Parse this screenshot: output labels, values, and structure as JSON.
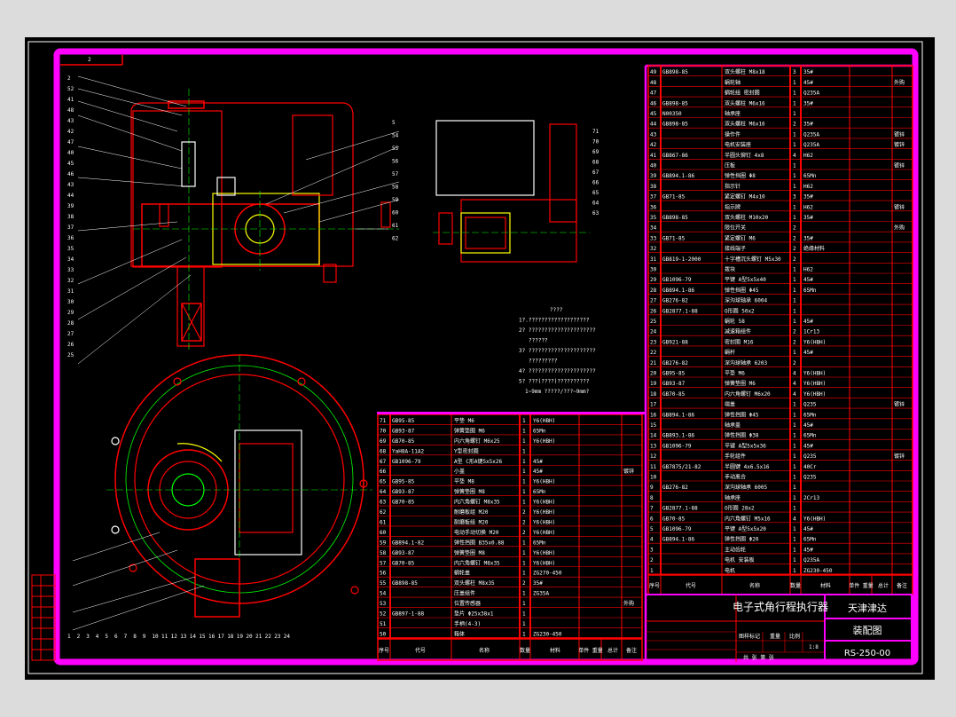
{
  "title_block": {
    "product_name": "电子式角行程执行器",
    "company": "天津津达",
    "drawing_type": "装配图",
    "drawing_number": "RS-250-00",
    "scale": "1:8",
    "headers": [
      "图样标记",
      "重量",
      "比例"
    ],
    "count_label": "共 张 第 张"
  },
  "bom_headers": [
    "序号",
    "代号",
    "名称",
    "数量",
    "材料",
    "单件 重量",
    "总计",
    "备注"
  ],
  "frame_label": "2",
  "notes": [
    "????",
    "1?.???????????????????",
    "2? ?????????????????????",
    "??????",
    "3? ?????????????????????",
    "?????????",
    "4? ?????????????????????",
    "5? ???(????)??????????",
    "1~9mm ?????/???~9mm?"
  ],
  "bom_left": [
    [
      "71",
      "GB95-85",
      "平垫 M6",
      "1",
      "Y6(HBH)",
      ""
    ],
    [
      "70",
      "GB93-87",
      "弹簧垫圈 M6",
      "1",
      "65Mn",
      ""
    ],
    [
      "69",
      "GB70-85",
      "内六角螺钉 M6x25",
      "1",
      "Y6(HBH)",
      ""
    ],
    [
      "68",
      "YaH8A-11A2",
      "Y型密封圈",
      "1",
      "",
      ""
    ],
    [
      "67",
      "GB1096-79",
      "A型 C形A键5x5x26",
      "1",
      "45#",
      ""
    ],
    [
      "66",
      "",
      "小盖",
      "1",
      "45#",
      "镀锌"
    ],
    [
      "65",
      "GB95-85",
      "平垫 M8",
      "1",
      "Y6(HBH)",
      ""
    ],
    [
      "64",
      "GB93-87",
      "弹簧垫圈 M8",
      "1",
      "65Mn",
      ""
    ],
    [
      "63",
      "GB70-85",
      "内六角螺钉 M8x35",
      "1",
      "Y6(HBH)",
      ""
    ],
    [
      "62",
      "",
      "耐磨板组 M20",
      "2",
      "Y6(HBH)",
      ""
    ],
    [
      "61",
      "",
      "耐磨板组 M20",
      "2",
      "Y6(HBH)",
      ""
    ],
    [
      "60",
      "",
      "电动手动切换 M20",
      "2",
      "Y6(HBH)",
      ""
    ],
    [
      "59",
      "GB894.1-82",
      "弹性挡圈 B35x0.88",
      "1",
      "65Mn",
      ""
    ],
    [
      "58",
      "GB93-87",
      "弹簧垫圈 M8",
      "1",
      "Y6(HBH)",
      ""
    ],
    [
      "57",
      "GB70-85",
      "内六角螺钉 M8x35",
      "1",
      "Y6(HBH)",
      ""
    ],
    [
      "56",
      "",
      "蜗轮盖",
      "1",
      "ZG270-450",
      ""
    ],
    [
      "55",
      "GB898-85",
      "双头螺柱 M8x35",
      "2",
      "35#",
      ""
    ],
    [
      "54",
      "",
      "压盖组件",
      "1",
      "ZG35A",
      ""
    ],
    [
      "53",
      "",
      "位置传感器",
      "1",
      "",
      "外购"
    ],
    [
      "52",
      "GB897-1-88",
      "垫片 Φ25x38x1",
      "1",
      "",
      ""
    ],
    [
      "51",
      "",
      "手柄(4-3)",
      "1",
      "",
      ""
    ],
    [
      "50",
      "",
      "箱体",
      "1",
      "ZG230-450",
      ""
    ]
  ],
  "bom_right": [
    [
      "49",
      "GB898-85",
      "双头螺柱 M8x18",
      "3",
      "35#",
      ""
    ],
    [
      "48",
      "",
      "蜗轮轴",
      "1",
      "45#",
      "外购"
    ],
    [
      "47",
      "",
      "蜗轮组 密封圈",
      "1",
      "Q235A",
      ""
    ],
    [
      "46",
      "GB898-85",
      "双头螺柱 M6x16",
      "1",
      "35#",
      ""
    ],
    [
      "45",
      "N00350",
      "轴承座",
      "1",
      "",
      ""
    ],
    [
      "44",
      "GB898-85",
      "双头螺柱 M6x16",
      "2",
      "35#",
      ""
    ],
    [
      "43",
      "",
      "操作件",
      "1",
      "Q235A",
      "镀锌"
    ],
    [
      "42",
      "",
      "电机安装座",
      "1",
      "Q235A",
      "镀锌"
    ],
    [
      "41",
      "GB867-86",
      "半圆头铆钉 4x8",
      "4",
      "H62",
      ""
    ],
    [
      "40",
      "",
      "压板",
      "1",
      "",
      "镀锌"
    ],
    [
      "39",
      "GB894.1-86",
      "弹性挡圈 Φ8",
      "1",
      "65Mn",
      ""
    ],
    [
      "38",
      "",
      "指示针",
      "1",
      "H62",
      ""
    ],
    [
      "37",
      "GB71-85",
      "紧定螺钉 M4x10",
      "3",
      "35#",
      ""
    ],
    [
      "36",
      "",
      "指示牌",
      "1",
      "H62",
      "镀锌"
    ],
    [
      "35",
      "GB898-85",
      "双头螺柱 M10x20",
      "1",
      "35#",
      ""
    ],
    [
      "34",
      "",
      "限位开关",
      "2",
      "",
      "外购"
    ],
    [
      "33",
      "GB71-85",
      "紧定螺钉 M6",
      "2",
      "35#",
      ""
    ],
    [
      "32",
      "",
      "接线端子",
      "2",
      "绝缘材料",
      ""
    ],
    [
      "31",
      "GB819-1-2000",
      "十字槽沉头螺钉 M5x30",
      "2",
      "",
      ""
    ],
    [
      "30",
      "",
      "拨块",
      "1",
      "H62",
      ""
    ],
    [
      "29",
      "GB1096-79",
      "平键 A型5x5x40",
      "1",
      "45#",
      ""
    ],
    [
      "28",
      "GB894.1-86",
      "弹性挡圈 Φ45",
      "1",
      "65Mn",
      ""
    ],
    [
      "27",
      "GB276-82",
      "深沟球轴承 6004",
      "1",
      "",
      ""
    ],
    [
      "26",
      "GB2877.1-88",
      "O形圈 50x2",
      "1",
      "",
      ""
    ],
    [
      "25",
      "",
      "蜗轮 58",
      "1",
      "45#",
      ""
    ],
    [
      "24",
      "",
      "减速箱组件",
      "2",
      "1Cr13",
      ""
    ],
    [
      "23",
      "GB921-88",
      "密封圈 M16",
      "2",
      "Y6(HBH)",
      ""
    ],
    [
      "22",
      "",
      "蜗杆",
      "1",
      "45#",
      ""
    ],
    [
      "21",
      "GB276-82",
      "深沟球轴承 6203",
      "2",
      "",
      ""
    ],
    [
      "20",
      "GB95-85",
      "平垫 M6",
      "4",
      "Y6(HBH)",
      ""
    ],
    [
      "19",
      "GB93-87",
      "弹簧垫圈 M6",
      "4",
      "Y6(HBH)",
      ""
    ],
    [
      "18",
      "GB70-85",
      "内六角螺钉 M6x20",
      "4",
      "Y6(HBH)",
      ""
    ],
    [
      "17",
      "",
      "端盖",
      "1",
      "Q235",
      "镀锌"
    ],
    [
      "16",
      "GB894.1-86",
      "弹性挡圈 Φ45",
      "1",
      "65Mn",
      ""
    ],
    [
      "15",
      "",
      "轴承盖",
      "1",
      "45#",
      ""
    ],
    [
      "14",
      "GB893.1-86",
      "弹性挡圈 Φ38",
      "1",
      "65Mn",
      ""
    ],
    [
      "13",
      "GB1096-79",
      "平键 A型5x5x36",
      "1",
      "45#",
      ""
    ],
    [
      "12",
      "",
      "手轮组件",
      "1",
      "Q235",
      "镀锌"
    ],
    [
      "11",
      "GB7875/21-82",
      "半圆键 4x6.5x16",
      "1",
      "40Cr",
      ""
    ],
    [
      "10",
      "",
      "手动离合",
      "1",
      "Q235",
      ""
    ],
    [
      "9",
      "GB276-82",
      "深沟球轴承 6005",
      "1",
      "",
      ""
    ],
    [
      "8",
      "",
      "轴承座",
      "1",
      "2Cr13",
      ""
    ],
    [
      "7",
      "GB2877.1-88",
      "O形圈 28x2",
      "1",
      "",
      ""
    ],
    [
      "6",
      "GB70-85",
      "内六角螺钉 M5x16",
      "4",
      "Y6(HBH)",
      ""
    ],
    [
      "5",
      "GB1096-79",
      "平键 A型5x5x20",
      "1",
      "45#",
      ""
    ],
    [
      "4",
      "GB894.1-86",
      "弹性挡圈 Φ20",
      "1",
      "65Mn",
      ""
    ],
    [
      "3",
      "",
      "主动齿轮",
      "1",
      "45#",
      ""
    ],
    [
      "2",
      "",
      "电机 安装板",
      "1",
      "Q235A",
      ""
    ],
    [
      "1",
      "",
      "电机",
      "1",
      "ZG230-450",
      ""
    ]
  ],
  "callouts_left": [
    "2",
    "52",
    "41",
    "48",
    "43",
    "42",
    "47",
    "40",
    "45",
    "46",
    "43",
    "44",
    "39",
    "38",
    "37",
    "36",
    "35",
    "34",
    "33",
    "32",
    "31",
    "30",
    "29",
    "28",
    "27",
    "26",
    "25"
  ],
  "callouts_right": [
    "5",
    "54",
    "55",
    "56",
    "57",
    "58",
    "59",
    "60",
    "61",
    "62"
  ],
  "callouts_side": [
    "71",
    "70",
    "69",
    "68",
    "67",
    "66",
    "65",
    "64",
    "63"
  ],
  "callouts_bottom": [
    "1",
    "2",
    "3",
    "4",
    "5",
    "6",
    "7",
    "8",
    "9",
    "10",
    "11",
    "12",
    "13",
    "14",
    "15",
    "16",
    "17",
    "18",
    "19",
    "20",
    "21",
    "22",
    "23",
    "24"
  ]
}
